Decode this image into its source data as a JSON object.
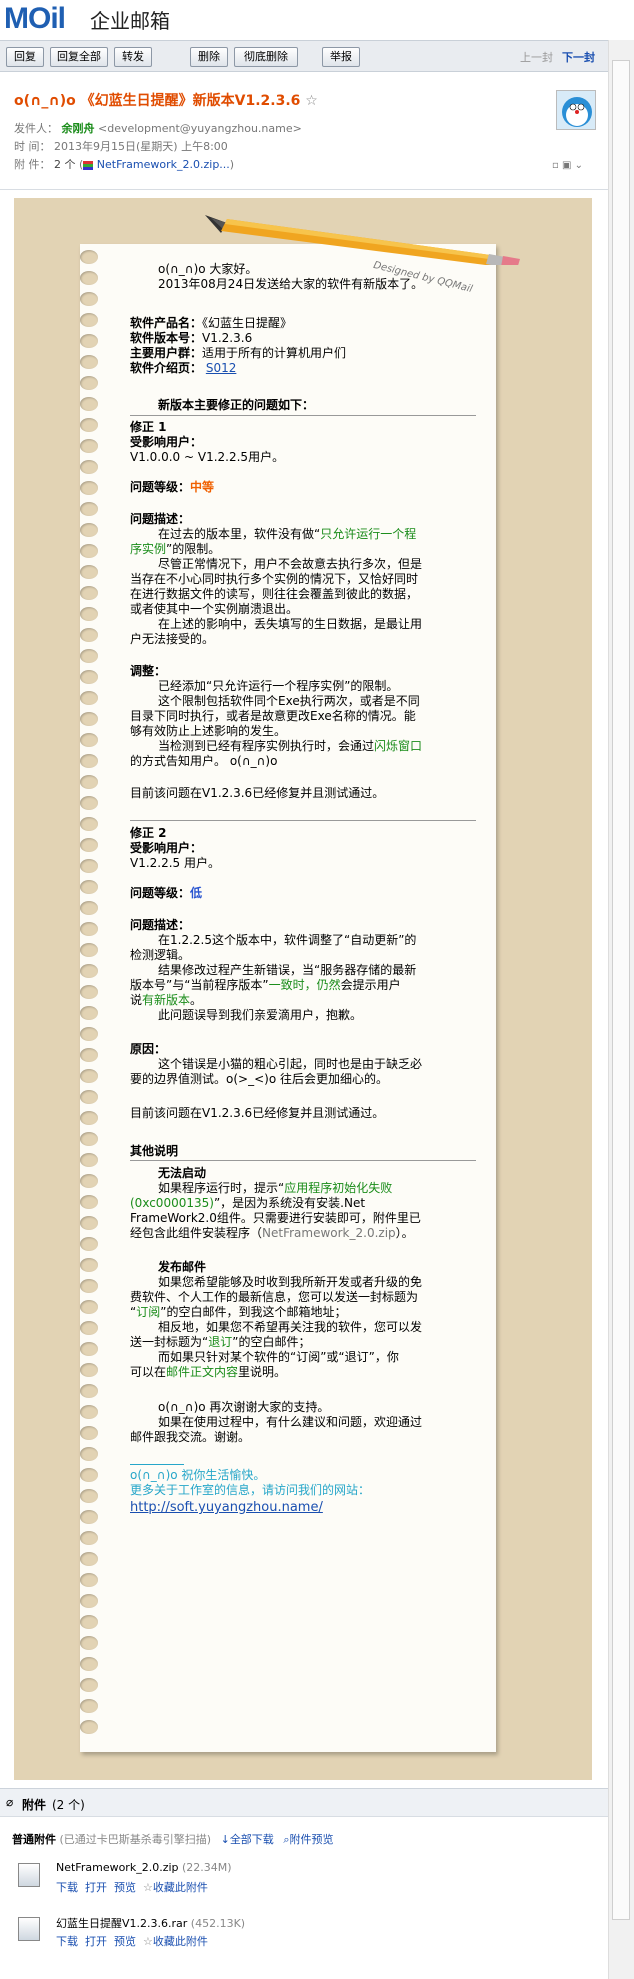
{
  "app": {
    "logo": "MOil",
    "logo_sub": "企业邮箱"
  },
  "toolbar": {
    "buttons": [
      "回复",
      "回复全部",
      "转发",
      "删除",
      "彻底删除",
      "举报"
    ],
    "prev": "上一封",
    "next": "下一封"
  },
  "mail": {
    "subject": "o(∩_∩)o 《幻蓝生日提醒》新版本V1.2.3.6",
    "star": "☆",
    "from_label": "发件人：",
    "from_name": "余刚舟",
    "from_email": "<development@yuyangzhou.name>",
    "time_label": "时 间：",
    "time_value": "2013年9月15日(星期天) 上午8:00",
    "attach_label": "附 件：",
    "attach_count": "2 个",
    "attach_file": "NetFramework_2.0.zip..."
  },
  "letter": {
    "designed": "Designed by QQMail",
    "greeting": "o(∩_∩)o 大家好。",
    "intro": "2013年08月24日发送给大家的软件有新版本了。",
    "name_label": "软件产品名：",
    "name_value": "《幻蓝生日提醒》",
    "ver_label": "软件版本号：",
    "ver_value": "V1.2.3.6",
    "users_label": "主要用户群：",
    "users_value": "适用于所有的计算机用户们",
    "page_label": "软件介绍页：",
    "page_link": "S012",
    "fix_title": "新版本主要修正的问题如下：",
    "fix1": {
      "title": "修正 1",
      "users_label": "受影响用户：",
      "users_value": "V1.0.0.0 ~ V1.2.2.5用户。",
      "level_label": "问题等级：",
      "level_value": "中等",
      "desc_label": "问题描述：",
      "desc_l1a": "在过去的版本里，软件没有做“",
      "desc_l1b": "只允许运行一个程",
      "desc_l2a": "序实例",
      "desc_l2b": "”的限制。",
      "desc_l3": "尽管正常情况下，用户不会故意去执行多次，但是",
      "desc_l4": "当存在不小心同时执行多个实例的情况下，又恰好同时",
      "desc_l5": "在进行数据文件的读写，则往往会覆盖到彼此的数据，",
      "desc_l6": "或者使其中一个实例崩溃退出。",
      "desc_l7": "在上述的影响中，丢失填写的生日数据，是最让用",
      "desc_l8": "户无法接受的。",
      "adj_label": "调整：",
      "adj_l1": "已经添加“只允许运行一个程序实例”的限制。",
      "adj_l2": "这个限制包括软件同个Exe执行两次，或者是不同",
      "adj_l3": "目录下同时执行，或者是故意更改Exe名称的情况。能",
      "adj_l4": "够有效防止上述影响的发生。",
      "adj_l5a": "当检测到已经有程序实例执行时，会通过",
      "adj_l5b": "闪烁窗口",
      "adj_l6": "的方式告知用户。 o(∩_∩)o",
      "done": "目前该问题在V1.2.3.6已经修复并且测试通过。"
    },
    "fix2": {
      "title": "修正 2",
      "users_label": "受影响用户：",
      "users_value": "V1.2.2.5 用户。",
      "level_label": "问题等级：",
      "level_value": "低",
      "desc_label": "问题描述：",
      "desc_l1": "在1.2.2.5这个版本中，软件调整了“自动更新”的",
      "desc_l2": "检测逻辑。",
      "desc_l3": "结果修改过程产生新错误，当“服务器存储的最新",
      "desc_l4a": "版本号”与“当前程序版本”",
      "desc_l4b": "一致时，仍然",
      "desc_l4c": "会提示用户",
      "desc_l5a": "说",
      "desc_l5b": "有新版本",
      "desc_l5c": "。",
      "desc_l6": "此问题误导到我们亲爱滴用户，抱歉。",
      "reason_label": "原因：",
      "reason_l1": "这个错误是小猫的粗心引起，同时也是由于缺乏必",
      "reason_l2": "要的边界值测试。o(>_<)o 往后会更加细心的。",
      "done": "目前该问题在V1.2.3.6已经修复并且测试通过。"
    },
    "other_title": "其他说明",
    "cant_start_title": "无法启动",
    "cant_l1a": "如果程序运行时，提示“",
    "cant_l1b": "应用程序初始化失败",
    "cant_l2a": "(0xc0000135)",
    "cant_l2b": "”，是因为系统没有安装.Net",
    "cant_l3": "FrameWork2.0组件。只需要进行安装即可，附件里已",
    "cant_l4a": "经包含此组件安装程序（",
    "cant_l4b": "NetFramework_2.0.zip",
    "cant_l4c": "）。",
    "mail_title": "发布邮件",
    "mail_l1": "如果您希望能够及时收到我所新开发或者升级的免",
    "mail_l2": "费软件、个人工作的最新信息，您可以发送一封标题为",
    "mail_l3a": "“",
    "mail_l3b": "订阅",
    "mail_l3c": "”的空白邮件，到我这个邮箱地址；",
    "mail_l4": "相反地，如果您不希望再关注我的软件，您可以发",
    "mail_l5a": "送一封标题为“",
    "mail_l5b": "退订",
    "mail_l5c": "”的空白邮件；",
    "mail_l6": "而如果只针对某个软件的“订阅”或“退订”，你",
    "mail_l7a": "可以在",
    "mail_l7b": "邮件正文内容",
    "mail_l7c": "里说明。",
    "thanks_l1": "o(∩_∩)o 再次谢谢大家的支持。",
    "thanks_l2": "如果在使用过程中，有什么建议和问题，欢迎通过",
    "thanks_l3": "邮件跟我交流。谢谢。",
    "sig_l1": "o(∩_∩)o 祝你生活愉快。",
    "sig_l2": "更多关于工作室的信息，请访问我们的网站：",
    "sig_link": "http://soft.yuyangzhou.name/"
  },
  "attachments": {
    "title": "附件",
    "count": "(2 个)",
    "section": "普通附件",
    "scan_note": "(已通过卡巴斯基杀毒引擎扫描)",
    "download_all": "全部下载",
    "preview_all": "附件预览",
    "files": [
      {
        "name": "NetFramework_2.0.zip",
        "size": "(22.34M)"
      },
      {
        "name": "幻蓝生日提醒V1.2.3.6.rar",
        "size": "(452.13K)"
      }
    ],
    "actions": {
      "download": "下载",
      "open": "打开",
      "preview": "预览",
      "save": "收藏此附件"
    }
  }
}
